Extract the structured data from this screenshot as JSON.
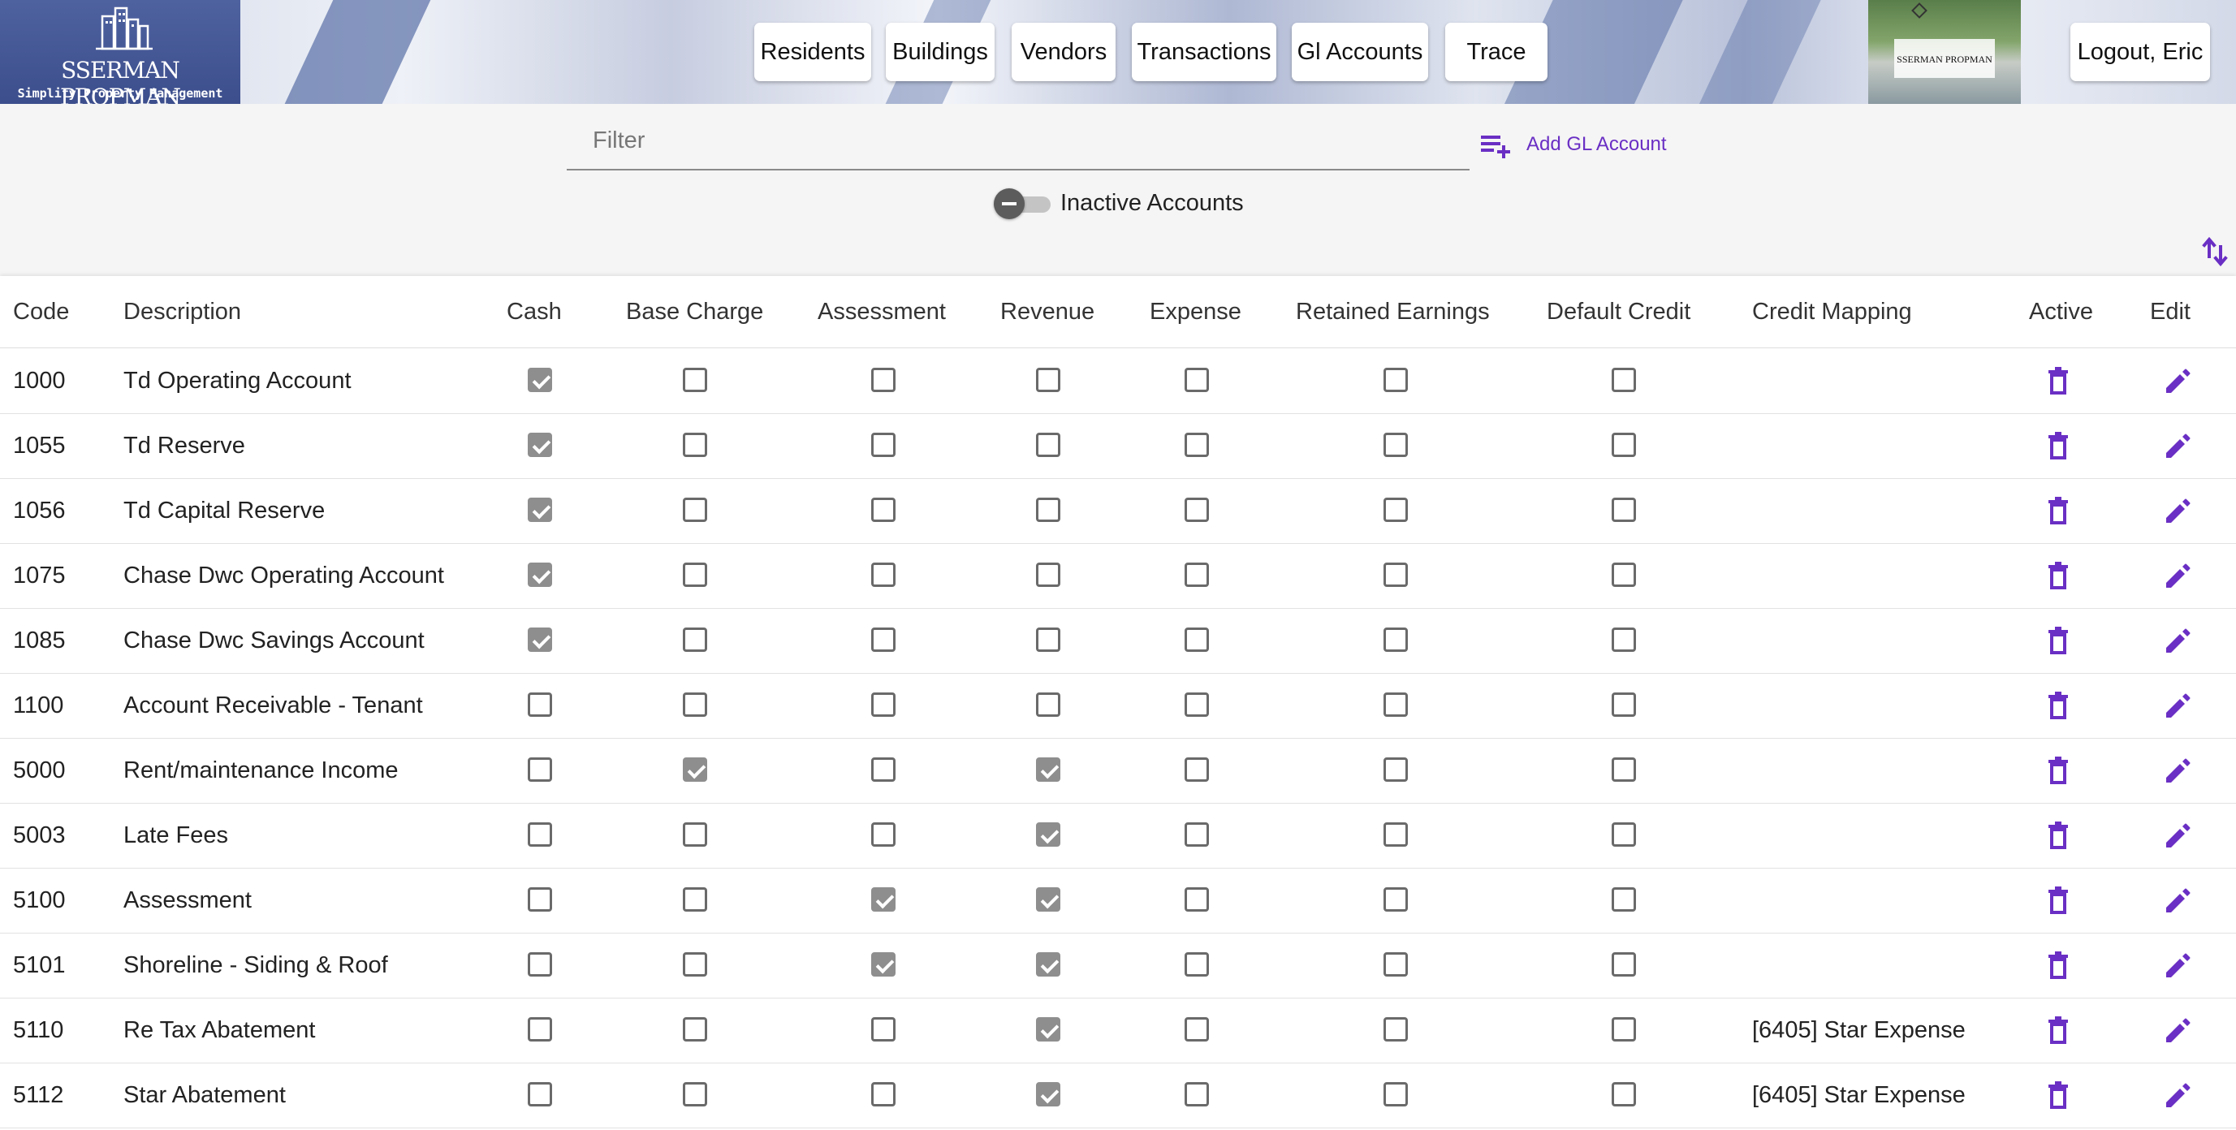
{
  "header": {
    "logo_name": "SSERMAN PROPMAN",
    "logo_tagline": "Simplify Property Management",
    "nav": [
      "Residents",
      "Buildings",
      "Vendors",
      "Transactions",
      "Gl Accounts",
      "Trace"
    ],
    "photo_caption": "SSERMAN PROPMAN",
    "logout_label": "Logout, Eric"
  },
  "toolbar": {
    "filter_placeholder": "Filter",
    "filter_value": "",
    "add_label": "Add GL Account",
    "inactive_toggle_label": "Inactive Accounts",
    "inactive_toggle_on": false
  },
  "accent_color": "#6a2fc4",
  "table": {
    "columns": [
      "Code",
      "Description",
      "Cash",
      "Base Charge",
      "Assessment",
      "Revenue",
      "Expense",
      "Retained Earnings",
      "Default Credit",
      "Credit Mapping",
      "Active",
      "Edit"
    ],
    "rows": [
      {
        "code": "1000",
        "description": "Td Operating Account",
        "cash": true,
        "base_charge": false,
        "assessment": false,
        "revenue": false,
        "expense": false,
        "retained_earnings": false,
        "default_credit": false,
        "credit_mapping": ""
      },
      {
        "code": "1055",
        "description": "Td Reserve",
        "cash": true,
        "base_charge": false,
        "assessment": false,
        "revenue": false,
        "expense": false,
        "retained_earnings": false,
        "default_credit": false,
        "credit_mapping": ""
      },
      {
        "code": "1056",
        "description": "Td Capital Reserve",
        "cash": true,
        "base_charge": false,
        "assessment": false,
        "revenue": false,
        "expense": false,
        "retained_earnings": false,
        "default_credit": false,
        "credit_mapping": ""
      },
      {
        "code": "1075",
        "description": "Chase Dwc Operating Account",
        "cash": true,
        "base_charge": false,
        "assessment": false,
        "revenue": false,
        "expense": false,
        "retained_earnings": false,
        "default_credit": false,
        "credit_mapping": ""
      },
      {
        "code": "1085",
        "description": "Chase Dwc Savings Account",
        "cash": true,
        "base_charge": false,
        "assessment": false,
        "revenue": false,
        "expense": false,
        "retained_earnings": false,
        "default_credit": false,
        "credit_mapping": ""
      },
      {
        "code": "1100",
        "description": "Account Receivable - Tenant",
        "cash": false,
        "base_charge": false,
        "assessment": false,
        "revenue": false,
        "expense": false,
        "retained_earnings": false,
        "default_credit": false,
        "credit_mapping": ""
      },
      {
        "code": "5000",
        "description": "Rent/maintenance Income",
        "cash": false,
        "base_charge": true,
        "assessment": false,
        "revenue": true,
        "expense": false,
        "retained_earnings": false,
        "default_credit": false,
        "credit_mapping": ""
      },
      {
        "code": "5003",
        "description": "Late Fees",
        "cash": false,
        "base_charge": false,
        "assessment": false,
        "revenue": true,
        "expense": false,
        "retained_earnings": false,
        "default_credit": false,
        "credit_mapping": ""
      },
      {
        "code": "5100",
        "description": "Assessment",
        "cash": false,
        "base_charge": false,
        "assessment": true,
        "revenue": true,
        "expense": false,
        "retained_earnings": false,
        "default_credit": false,
        "credit_mapping": ""
      },
      {
        "code": "5101",
        "description": "Shoreline - Siding & Roof",
        "cash": false,
        "base_charge": false,
        "assessment": true,
        "revenue": true,
        "expense": false,
        "retained_earnings": false,
        "default_credit": false,
        "credit_mapping": ""
      },
      {
        "code": "5110",
        "description": "Re Tax Abatement",
        "cash": false,
        "base_charge": false,
        "assessment": false,
        "revenue": true,
        "expense": false,
        "retained_earnings": false,
        "default_credit": false,
        "credit_mapping": "[6405] Star Expense"
      },
      {
        "code": "5112",
        "description": "Star Abatement",
        "cash": false,
        "base_charge": false,
        "assessment": false,
        "revenue": true,
        "expense": false,
        "retained_earnings": false,
        "default_credit": false,
        "credit_mapping": "[6405] Star Expense"
      }
    ]
  }
}
